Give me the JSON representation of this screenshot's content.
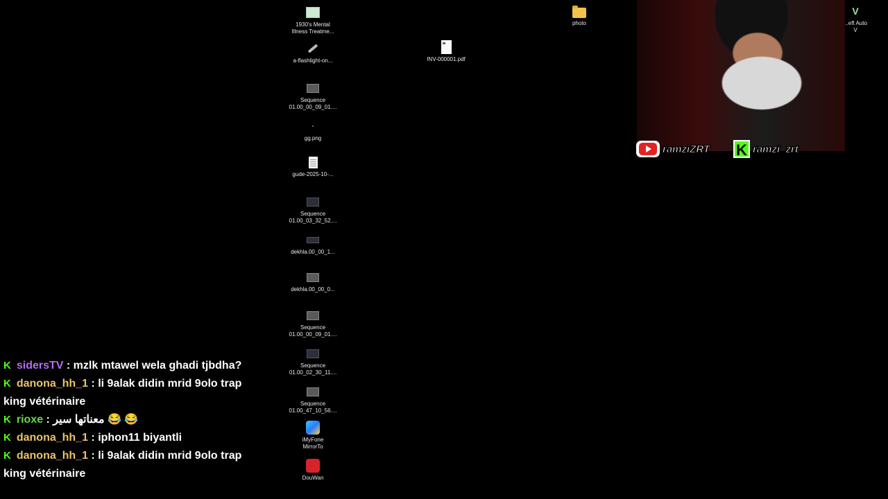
{
  "desktop": {
    "icons": [
      {
        "label": "1930's Mental\nIllness Treatme...",
        "icon": "image-file-icon"
      },
      {
        "label": "a-flashlight-on...",
        "icon": "flashlight-image-icon"
      },
      {
        "label": "Sequence\n01.00_00_09_01....",
        "icon": "video-thumbnail-icon"
      },
      {
        "label": "gg.png",
        "icon": "png-file-icon"
      },
      {
        "label": "gude-2025-10-...",
        "icon": "document-icon"
      },
      {
        "label": "Sequence\n01.00_03_32_52....",
        "icon": "video-thumbnail-icon"
      },
      {
        "label": "dekhla.00_00_1...",
        "icon": "video-thumbnail-icon"
      },
      {
        "label": "dekhla.00_00_0...",
        "icon": "video-thumbnail-icon"
      },
      {
        "label": "Sequence\n01.00_00_09_01....",
        "icon": "video-thumbnail-icon"
      },
      {
        "label": "Sequence\n01.00_02_30_11....",
        "icon": "video-thumbnail-icon"
      },
      {
        "label": "Sequence\n01.00_47_10_56....",
        "icon": "video-thumbnail-icon"
      },
      {
        "label": "iMyFone\nMirrorTo",
        "icon": "imyfone-app-icon"
      },
      {
        "label": "DouWan",
        "icon": "douwan-app-icon"
      }
    ],
    "pdf": {
      "label": "INV-000001.pdf"
    },
    "folder": {
      "label": "photo"
    },
    "gta": {
      "label": "...eft Auto\nV"
    }
  },
  "overlay": {
    "youtube_handle": "ramziZRT",
    "kick_handle": "ramzi_zrt"
  },
  "chat": [
    {
      "user": "sidersTV",
      "user_color": "#b46cf7",
      "text": " : mzlk mtawel wela ghadi tjbdha?"
    },
    {
      "user": "danona_hh_1",
      "user_color": "#e9c46a",
      "text": " : li 9alak didin mrid 9olo trap king vétérinaire"
    },
    {
      "user": "rioxe",
      "user_color": "#6bd64b",
      "text": " : معناتها سير 😂 😂"
    },
    {
      "user": "danona_hh_1",
      "user_color": "#e9c46a",
      "text": " : iphon11 biyantli"
    },
    {
      "user": "danona_hh_1",
      "user_color": "#e9c46a",
      "text": " : li 9alak didin mrid 9olo trap king vétérinaire"
    }
  ],
  "colors": {
    "kick_green": "#53fc18",
    "youtube_red": "#e52222"
  }
}
